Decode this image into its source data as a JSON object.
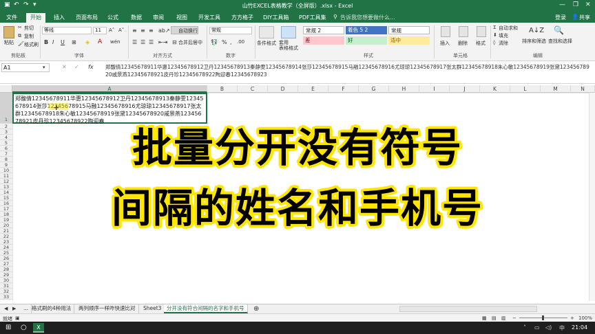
{
  "window": {
    "title": "山竹EXCEL表格教学（全屏版）.xlsx - Excel",
    "buttons": [
      "—",
      "❐",
      "✕"
    ]
  },
  "menu": {
    "items": [
      "文件",
      "开始",
      "插入",
      "页面布局",
      "公式",
      "数据",
      "审阅",
      "视图",
      "开发工具",
      "方方格子",
      "DIY工具箱",
      "PDF工具集"
    ],
    "search_placeholder": "告诉我您想要做什么...",
    "login": "登录",
    "share": "共享"
  },
  "ribbon": {
    "paste": "粘贴",
    "cut": "剪切",
    "copy": "复制",
    "format_painter": "格式刷",
    "clipboard": "剪贴板",
    "font_name": "等线",
    "font_size": "11",
    "font_grp": "字体",
    "wrap_text": "自动换行",
    "merge_center": "合并后居中",
    "align_grp": "对齐方式",
    "number_format": "常规",
    "number_grp": "数字",
    "cond_format": "条件格式",
    "table_format": "套用\n表格格式",
    "styles": {
      "normal2": "常规 2",
      "accent": "着色 5 2",
      "normal": "常规",
      "bad": "差",
      "good": "好",
      "neutral": "适中"
    },
    "styles_grp": "样式",
    "insert": "插入",
    "delete": "删除",
    "format": "格式",
    "cells_grp": "单元格",
    "autosum": "自动求和",
    "fill": "填充",
    "clear": "清除",
    "sort_filter": "排序和筛选",
    "find_select": "查找和选择",
    "edit_grp": "编辑"
  },
  "formula_bar": {
    "name_box": "A1",
    "fx": "fx",
    "content": "郑馥倩12345678911华惠12345678912卫丹12345678913秦静雯12345678914张莎12345678915马融12345678916尤琼琼12345678917张太群12345678918朱心敏12345678919张黛12345678920戚景燕12345678921皮丹珍12345678922陶迎春12345678923"
  },
  "columns": [
    "A",
    "B",
    "C",
    "D",
    "E",
    "F",
    "G",
    "H",
    "I",
    "J",
    "K",
    "L",
    "M",
    "N"
  ],
  "rows": [
    "1",
    "2",
    "3",
    "4",
    "5",
    "6",
    "7",
    "8",
    "9",
    "10",
    "11",
    "12",
    "13",
    "14",
    "15",
    "16",
    "17",
    "18",
    "19",
    "20",
    "21",
    "22",
    "23",
    "24",
    "25",
    "26",
    "27",
    "28",
    "29",
    "30",
    "31",
    "32",
    "33"
  ],
  "cell_a1": "郑馥倩12345678911华惠12345678912卫丹12345678913秦静雯12345678914张莎12345678915马融12345678916尤琼琼12345678917张太群12345678918朱心敏12345678919张黛12345678920戚景燕12345678921皮丹珍12345678922陶迎春",
  "overlay": {
    "line1": "批量分开没有符号",
    "line2": "间隔的姓名和手机号"
  },
  "sheet_tabs": [
    "...",
    "格式刷的4种用法",
    "两列顺序一样咋快速比对",
    "Sheet3",
    "分开没有符合间隔的名字和手机号"
  ],
  "status": {
    "ready": "就绪",
    "zoom": "100%"
  },
  "taskbar": {
    "clock": "21:04"
  },
  "colors": {
    "excel_green": "#217346",
    "highlight_yellow": "#ffe600"
  }
}
